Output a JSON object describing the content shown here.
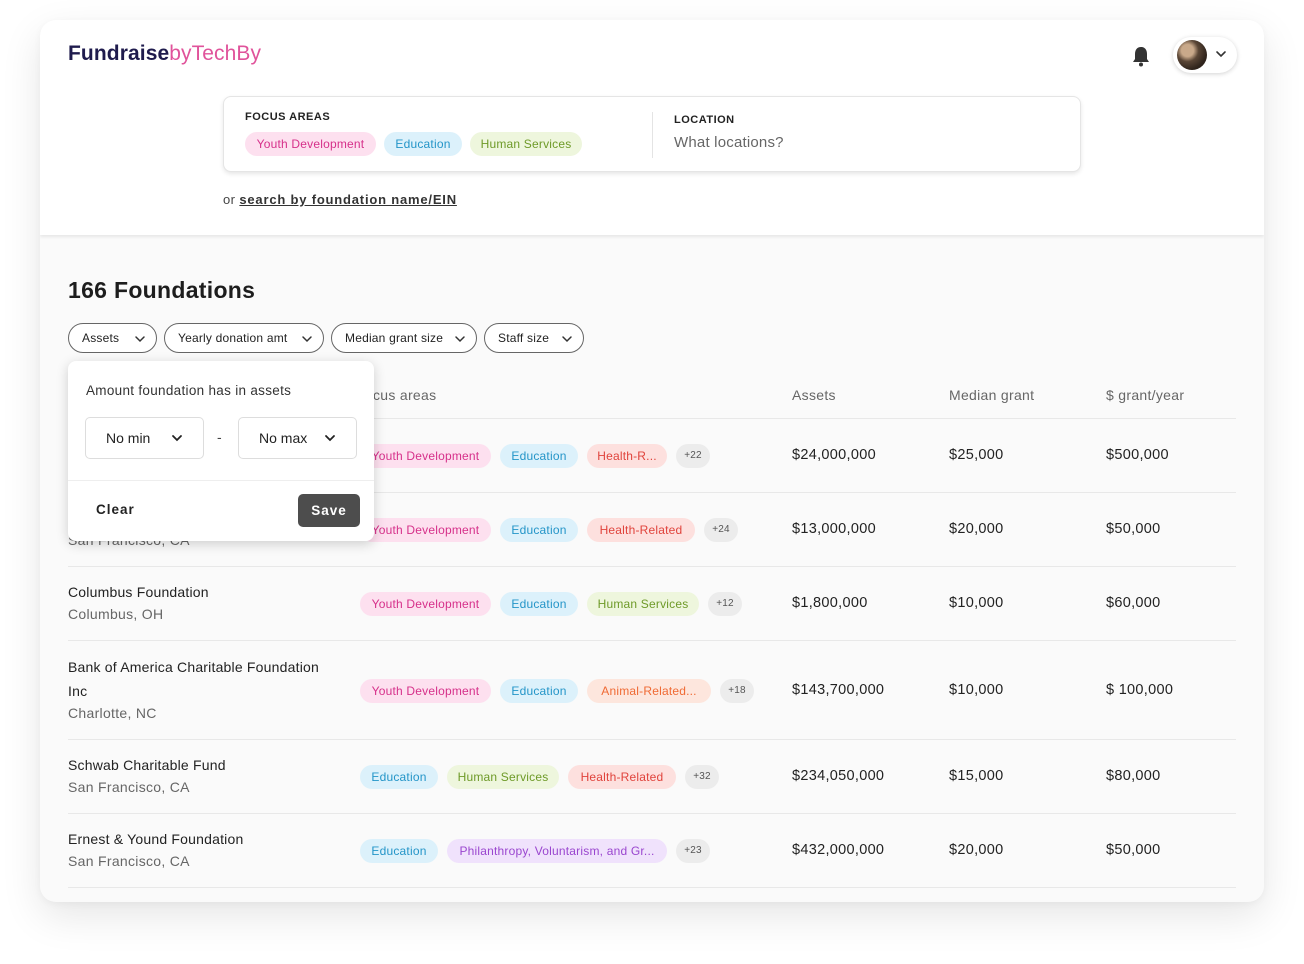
{
  "brand": {
    "name_bold": "Fundraise",
    "name_light": "byTechBy"
  },
  "header": {
    "bell_icon": "bell-icon",
    "avatar_icon": "user-avatar",
    "menu_icon": "chevron-down-icon"
  },
  "search": {
    "focus_label": "FOCUS AREAS",
    "focus_tags": [
      {
        "label": "Youth Development",
        "color": "#d6308a"
      },
      {
        "label": "Education",
        "color": "#2495c8"
      },
      {
        "label": "Human Services",
        "color": "#6e9a28"
      }
    ],
    "location_label": "LOCATION",
    "location_placeholder": "What locations?",
    "or_text": "or",
    "alt_link": "search by foundation name/EIN"
  },
  "results": {
    "count_title": "166 Foundations",
    "filters": [
      "Assets",
      "Yearly donation amt",
      "Median grant size",
      "Staff size"
    ],
    "columns": {
      "focus": "Focus areas",
      "focus_visible": "cus areas",
      "assets": "Assets",
      "median": "Median grant",
      "per_year": "$ grant/year"
    },
    "rows": [
      {
        "name": "",
        "location": "",
        "tags": [
          [
            "Youth Development",
            "pink"
          ],
          [
            "Education",
            "blue"
          ],
          [
            "Health-R...",
            "red"
          ]
        ],
        "more": "+22",
        "assets": "$24,000,000",
        "median": "$25,000",
        "per_year": "$500,000"
      },
      {
        "name": "",
        "location": "San Francisco, CA",
        "tags": [
          [
            "Youth Development",
            "pink"
          ],
          [
            "Education",
            "blue"
          ],
          [
            "Health-Related",
            "red"
          ]
        ],
        "more": "+24",
        "assets": "$13,000,000",
        "median": "$20,000",
        "per_year": "$50,000"
      },
      {
        "name": "Columbus Foundation",
        "location": "Columbus, OH",
        "tags": [
          [
            "Youth Development",
            "pink"
          ],
          [
            "Education",
            "blue"
          ],
          [
            "Human Services",
            "green"
          ]
        ],
        "more": "+12",
        "assets": "$1,800,000",
        "median": "$10,000",
        "per_year": "$60,000"
      },
      {
        "name": "Bank of America Charitable Foundation Inc",
        "location": "Charlotte, NC",
        "tags": [
          [
            "Youth Development",
            "pink"
          ],
          [
            "Education",
            "blue"
          ],
          [
            "Animal-Related...",
            "orange"
          ]
        ],
        "more": "+18",
        "assets": "$143,700,000",
        "median": "$10,000",
        "per_year": "$ 100,000"
      },
      {
        "name": "Schwab Charitable Fund",
        "location": "San Francisco, CA",
        "tags": [
          [
            "Education",
            "blue"
          ],
          [
            "Human Services",
            "green"
          ],
          [
            "Health-Related",
            "red"
          ]
        ],
        "more": "+32",
        "assets": "$234,050,000",
        "median": "$15,000",
        "per_year": "$80,000"
      },
      {
        "name": "Ernest & Yound Foundation",
        "location": "San Francisco, CA",
        "tags": [
          [
            "Education",
            "blue"
          ],
          [
            "Philanthropy, Voluntarism, and Gr...",
            "purple"
          ]
        ],
        "more": "+23",
        "assets": "$432,000,000",
        "median": "$20,000",
        "per_year": "$50,000"
      }
    ]
  },
  "assets_dropdown": {
    "title": "Amount foundation has in assets",
    "min": "No min",
    "dash": "-",
    "max": "No max",
    "clear": "Clear",
    "save": "Save"
  }
}
